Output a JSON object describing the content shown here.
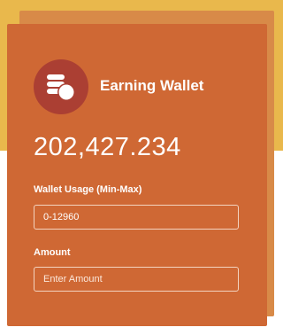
{
  "wallet": {
    "title": "Earning Wallet",
    "balance": "202,427.234",
    "icon": "coins-icon"
  },
  "form": {
    "usage_label": "Wallet Usage (Min-Max)",
    "usage_value": "0-12960",
    "amount_label": "Amount",
    "amount_placeholder": "Enter Amount"
  },
  "colors": {
    "background_top": "#e9b84c",
    "card": "#cf6834",
    "card_shadow": "#d88a48",
    "icon_badge": "#ab3f33"
  }
}
